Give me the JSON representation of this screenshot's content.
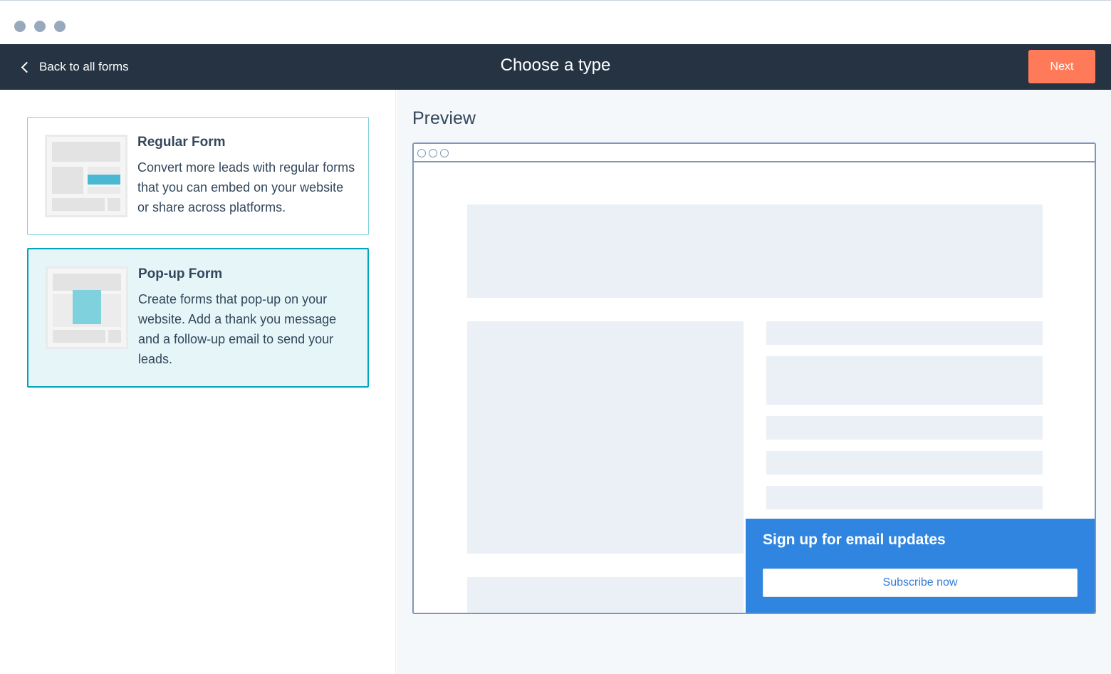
{
  "window": {
    "dots": [
      "dot-1",
      "dot-2",
      "dot-3"
    ]
  },
  "header": {
    "back_label": "Back to all forms",
    "title": "Choose a type",
    "next_label": "Next"
  },
  "form_types": [
    {
      "title": "Regular Form",
      "description": "Convert more leads with regular forms that you can embed on your website or share across platforms.",
      "selected": false
    },
    {
      "title": "Pop-up Form",
      "description": "Create forms that pop-up on your website. Add a thank you message and a follow-up email to send your leads.",
      "selected": true
    }
  ],
  "preview": {
    "title": "Preview",
    "popup_heading": "Sign up for email updates",
    "popup_button": "Subscribe now"
  },
  "colors": {
    "header_bg": "#253342",
    "accent_orange": "#ff7a59",
    "selected_border": "#00a4bd",
    "popup_blue": "#2f85e0"
  }
}
